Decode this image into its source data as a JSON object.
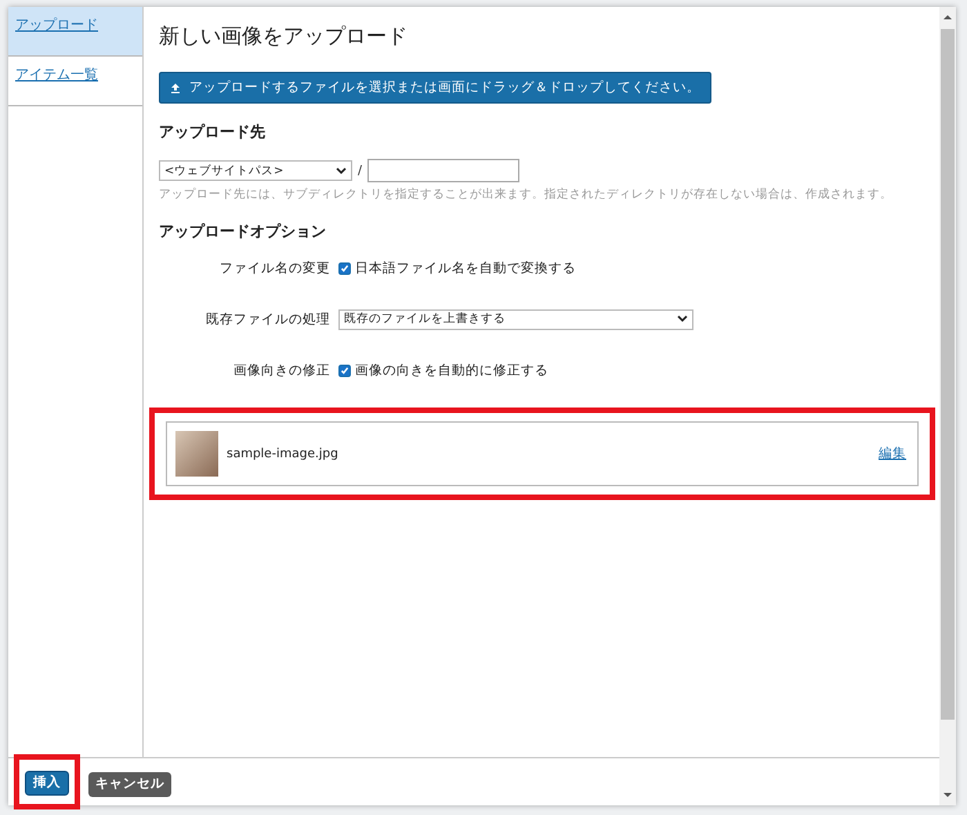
{
  "sidebar": {
    "items": [
      {
        "label": "アップロード",
        "selected": true
      },
      {
        "label": "アイテム一覧",
        "selected": false
      }
    ]
  },
  "dialog": {
    "title": "新しい画像をアップロード"
  },
  "upload_button": {
    "label": "アップロードするファイルを選択または画面にドラッグ＆ドロップしてください。"
  },
  "destination": {
    "heading": "アップロード先",
    "select_value": "<ウェブサイトパス>",
    "separator": "/",
    "hint": "アップロード先には、サブディレクトリを指定することが出来ます。指定されたディレクトリが存在しない場合は、作成されます。"
  },
  "options": {
    "heading": "アップロードオプション",
    "rows": [
      {
        "kind": "checkbox",
        "label": "ファイル名の変更",
        "value": "日本語ファイル名を自動で変換する",
        "checked": true
      },
      {
        "kind": "select",
        "label": "既存ファイルの処理",
        "value": "既存のファイルを上書きする"
      },
      {
        "kind": "checkbox",
        "label": "画像向きの修正",
        "value": "画像の向きを自動的に修正する",
        "checked": true
      }
    ]
  },
  "file": {
    "name": "sample-image.jpg",
    "link": "編集",
    "highlighted": true
  },
  "footer": {
    "buttons": [
      {
        "label": "挿入",
        "kind": "primary",
        "highlighted": true
      },
      {
        "label": "キャンセル",
        "kind": "secondary",
        "highlighted": false
      }
    ]
  }
}
